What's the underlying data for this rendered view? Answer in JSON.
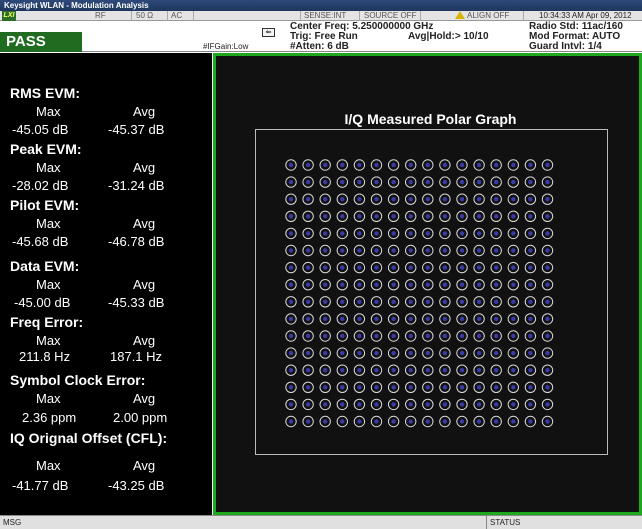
{
  "window_title": "Keysight WLAN - Modulation Analysis",
  "sense_bar": {
    "logo": "LXI",
    "rf": "RF",
    "impedance": "50 Ω",
    "coupling": "AC",
    "sense": "SENSE:INT",
    "source": "SOURCE OFF",
    "align": "ALIGN OFF",
    "datetime": "10:34:33 AM Apr 09, 2012"
  },
  "status": {
    "result": "PASS",
    "if_gain": "#IFGain:Low",
    "center_freq": "Center Freq: 5.250000000 GHz",
    "trig": "Trig: Free Run",
    "avg_hold": "Avg|Hold:> 10/10",
    "atten": "#Atten: 6 dB",
    "radio_std": "Radio Std: 11ac/160",
    "mod_format": "Mod Format: AUTO",
    "guard_intvl": "Guard Intvl: 1/4"
  },
  "metrics": {
    "max_label": "Max",
    "avg_label": "Avg",
    "rms_evm": {
      "title": "RMS EVM:",
      "max": "-45.05  dB",
      "avg": "-45.37  dB"
    },
    "peak_evm": {
      "title": "Peak EVM:",
      "max": "-28.02  dB",
      "avg": "-31.24  dB"
    },
    "pilot_evm": {
      "title": "Pilot EVM:",
      "max": "-45.68  dB",
      "avg": "-46.78  dB"
    },
    "data_evm": {
      "title": "Data EVM:",
      "max": "-45.00  dB",
      "avg": "-45.33  dB"
    },
    "freq_error": {
      "title": "Freq Error:",
      "max": "211.8 Hz",
      "avg": "187.1 Hz"
    },
    "symbol_clock": {
      "title": "Symbol Clock Error:",
      "max": "2.36 ppm",
      "avg": "2.00 ppm"
    },
    "iq_offset": {
      "title": "IQ Orignal Offset (CFL):",
      "max": "-41.77  dB",
      "avg": "-43.25  dB"
    }
  },
  "graph": {
    "title": "I/Q Measured Polar Graph",
    "constellation": {
      "rows": 16,
      "cols": 16
    },
    "colors": {
      "ring": "#d8d8d8",
      "core": "#3a3aa8",
      "frame": "#1ea81e"
    }
  },
  "bottom": {
    "msg": "MSG",
    "status": "STATUS"
  }
}
